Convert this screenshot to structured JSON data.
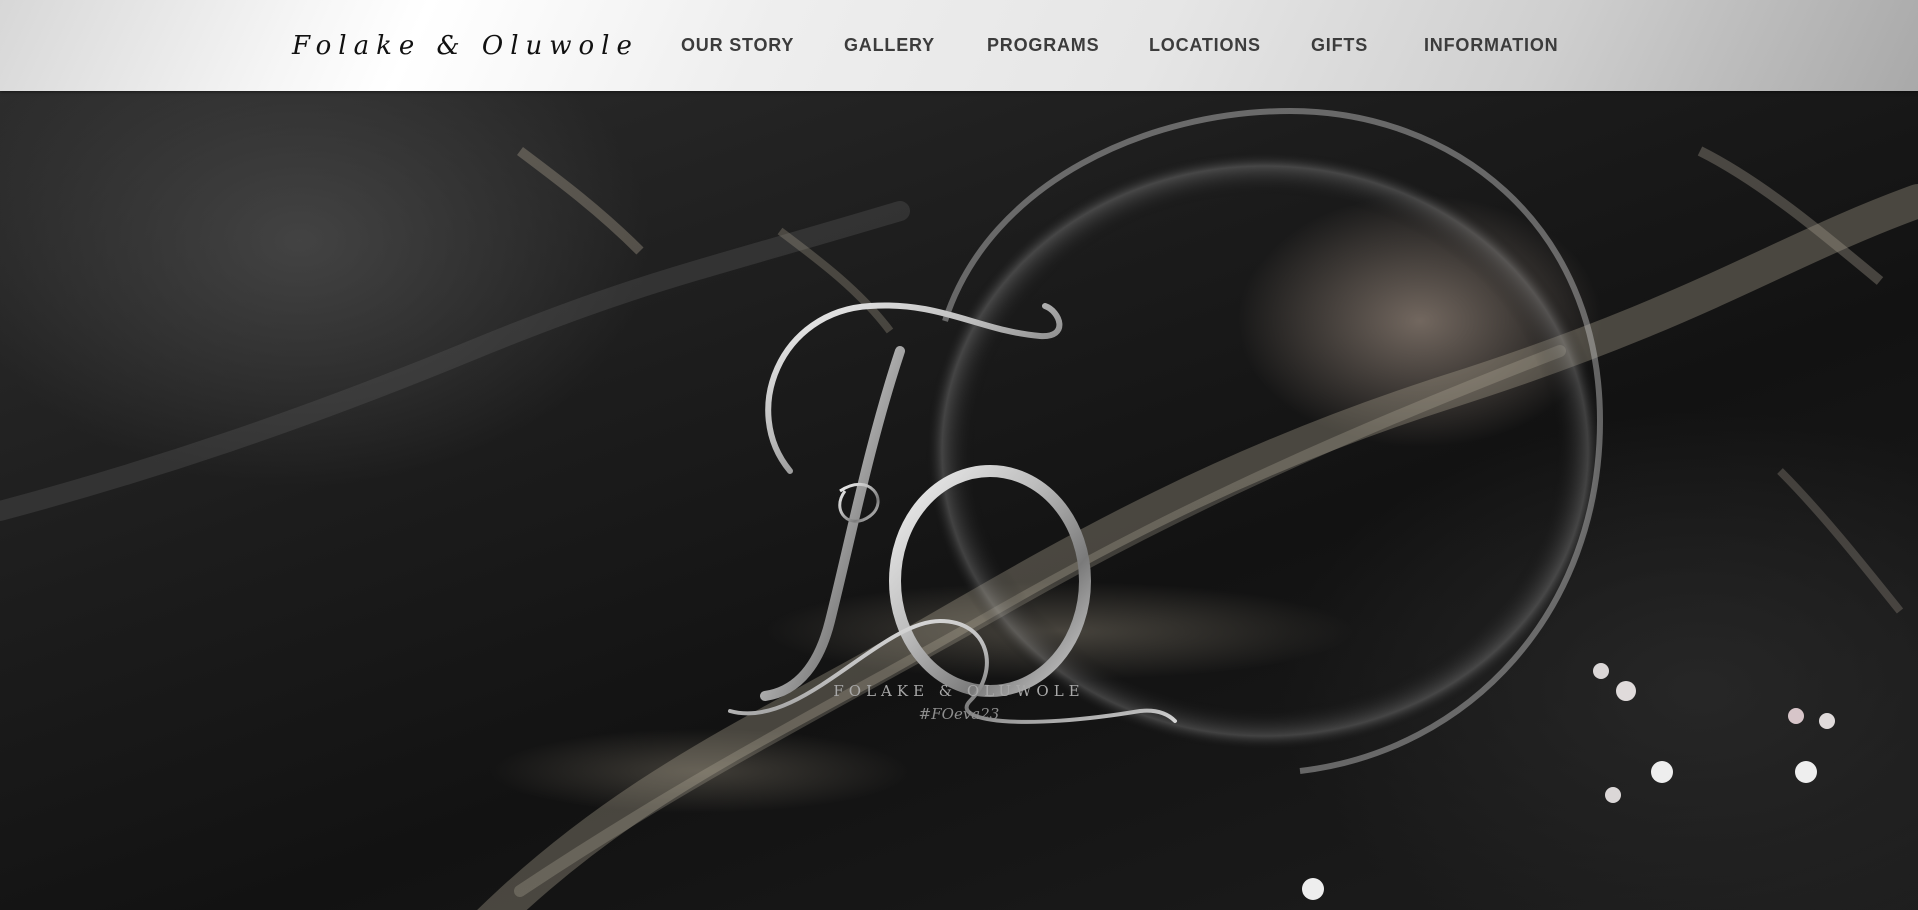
{
  "header": {
    "brand": "Folake & Oluwole",
    "nav": [
      {
        "label": "OUR STORY"
      },
      {
        "label": "GALLERY"
      },
      {
        "label": "PROGRAMS"
      },
      {
        "label": "LOCATIONS"
      },
      {
        "label": "GIFTS"
      },
      {
        "label": "INFORMATION"
      }
    ]
  },
  "hero": {
    "monogram": "FO",
    "name": "FOLAKE & OLUWOLE",
    "hashtag": "#FOeva23"
  },
  "colors": {
    "header_text": "#3c3c3c",
    "brand_text": "#111111",
    "hero_text": "#a8a8a8",
    "background": "#141414"
  }
}
